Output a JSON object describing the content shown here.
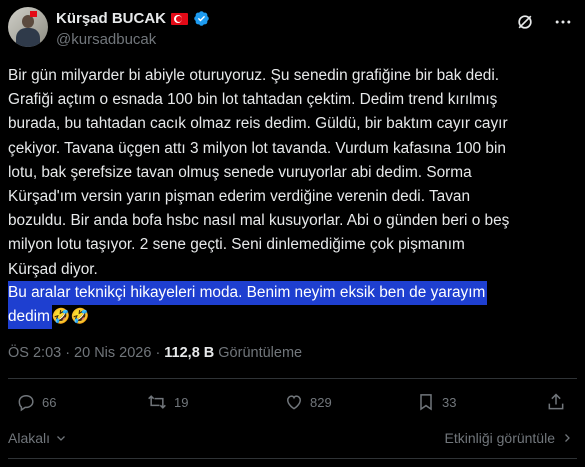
{
  "author": {
    "display_name": "Kürşad BUCAK",
    "handle": "@kursadbucak"
  },
  "tweet": {
    "text": "Bir gün milyarder bi abiyle oturuyoruz. Şu senedin grafiğine bir bak dedi.\nGrafiği açtım o esnada 100 bin lot tahtadan çektim. Dedim trend kırılmış\nburada, bu tahtadan cacık olmaz reis dedim. Güldü, bir baktım cayır cayır\nçekiyor. Tavana üçgen attı 3 milyon lot tavanda. Vurdum kafasına 100 bin\nlotu, bak şerefsize tavan olmuş senede vuruyorlar abi dedim. Sorma\nKürşad'ım versin yarın pişman ederim verdiğine verenin dedi. Tavan\nbozuldu. Bir anda bofa hsbc nasıl mal kusuyorlar. Abi o günden beri o beş\nmilyon lotu taşıyor. 2 sene geçti. Seni dinlemediğime çok pişmanım\nKürşad diyor.",
    "highlight_line1": "Bu aralar teknikçi hikayeleri moda. Benim neyim eksik ben de yarayım",
    "highlight_line2": "dedim",
    "emoji": "🤣🤣"
  },
  "meta": {
    "time": "ÖS 2:03",
    "separator": "·",
    "date": "20 Nis 2026",
    "views_count": "112,8 B",
    "views_label": "Görüntüleme"
  },
  "actions": {
    "replies": "66",
    "reposts": "19",
    "likes": "829",
    "bookmarks": "33"
  },
  "footer": {
    "related_label": "Alakalı",
    "activity_label": "Etkinliği görüntüle"
  },
  "colors": {
    "background": "#000000",
    "text": "#e7e9ea",
    "muted": "#71767b",
    "highlight": "#1e3fd0",
    "verified": "#1d9bf0"
  },
  "icons": [
    "grok-icon",
    "more-icon",
    "reply-icon",
    "repost-icon",
    "like-icon",
    "bookmark-icon",
    "share-icon",
    "chevron-down-icon",
    "chevron-right-icon",
    "verified-badge-icon",
    "turkey-flag-icon"
  ]
}
